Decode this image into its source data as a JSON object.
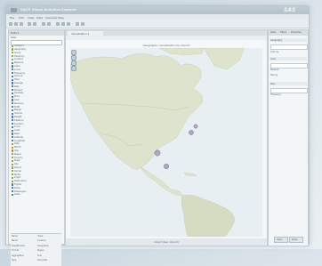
{
  "window": {
    "title": "SAS® Visual Analytics Explorer",
    "logo": "SAS",
    "menu": [
      "File",
      "Edit",
      "View",
      "Data",
      "Visualize",
      "Help"
    ]
  },
  "left_panel": {
    "title": "Data ▾ ",
    "tab": "Data",
    "items": [
      {
        "label": "Category",
        "color": "#8aa24a"
      },
      {
        "label": "Geography",
        "color": "#8aa24a"
      },
      {
        "label": "Group",
        "color": "#8aa24a"
      },
      {
        "label": "Hierarchy",
        "color": "#8aa24a"
      },
      {
        "label": "Location",
        "color": "#8aa24a"
      },
      {
        "label": "Measure",
        "color": "#4a73a8"
      },
      {
        "label": "Value",
        "color": "#4a73a8"
      },
      {
        "label": "Count",
        "color": "#4a73a8"
      },
      {
        "label": "Frequency",
        "color": "#4a73a8"
      },
      {
        "label": "Amount",
        "color": "#4a73a8"
      },
      {
        "label": "Total",
        "color": "#4a73a8"
      },
      {
        "label": "Average",
        "color": "#4a73a8"
      },
      {
        "label": "Rate",
        "color": "#4a73a8"
      },
      {
        "label": "Percent",
        "color": "#4a73a8"
      },
      {
        "label": "Quantity",
        "color": "#4a73a8"
      },
      {
        "label": "Price",
        "color": "#4a73a8"
      },
      {
        "label": "Cost",
        "color": "#4a73a8"
      },
      {
        "label": "Revenue",
        "color": "#4a73a8"
      },
      {
        "label": "Profit",
        "color": "#4a73a8"
      },
      {
        "label": "Margin",
        "color": "#4a73a8"
      },
      {
        "label": "Volume",
        "color": "#4a73a8"
      },
      {
        "label": "Weight",
        "color": "#4a73a8"
      },
      {
        "label": "Distance",
        "color": "#4a73a8"
      },
      {
        "label": "Duration",
        "color": "#4a73a8"
      },
      {
        "label": "Score",
        "color": "#4a73a8"
      },
      {
        "label": "Index",
        "color": "#4a73a8"
      },
      {
        "label": "Ratio",
        "color": "#4a73a8"
      },
      {
        "label": "Latitude",
        "color": "#4a73a8"
      },
      {
        "label": "Longitude",
        "color": "#4a73a8"
      },
      {
        "label": "Date",
        "color": "#b08a3a"
      },
      {
        "label": "Month",
        "color": "#b08a3a"
      },
      {
        "label": "Year",
        "color": "#b08a3a"
      },
      {
        "label": "Region",
        "color": "#8aa24a"
      },
      {
        "label": "Country",
        "color": "#8aa24a"
      },
      {
        "label": "State",
        "color": "#8aa24a"
      },
      {
        "label": "City",
        "color": "#8aa24a"
      },
      {
        "label": "Airport",
        "color": "#8aa24a"
      },
      {
        "label": "Carrier",
        "color": "#8aa24a"
      },
      {
        "label": "Route",
        "color": "#8aa24a"
      },
      {
        "label": "Origin",
        "color": "#8aa24a"
      },
      {
        "label": "Destination",
        "color": "#8aa24a"
      },
      {
        "label": "Flights",
        "color": "#4a73a8"
      },
      {
        "label": "Delay",
        "color": "#4a73a8"
      },
      {
        "label": "Passengers",
        "color": "#4a73a8"
      },
      {
        "label": "Seats",
        "color": "#4a73a8"
      }
    ],
    "properties": {
      "header": [
        "Name",
        "Value"
      ],
      "rows": [
        [
          "Name",
          "Location"
        ],
        [
          "Classification",
          "Geography"
        ],
        [
          "Format",
          "Region"
        ],
        [
          "Aggregation",
          "Sum"
        ],
        [
          "Type",
          "Character"
        ]
      ]
    }
  },
  "center": {
    "tab": "Visualization 1 ",
    "map_title": "Geographic visualization by Airport",
    "footer": "Airport (Geo: Airport)"
  },
  "right_panel": {
    "tabs": [
      "Roles",
      "Filters",
      "Properties"
    ],
    "sections": [
      "Geography",
      "Color",
      "Size"
    ],
    "field_labels": [
      "Color by",
      "Measure",
      "Size by",
      "Frequency"
    ],
    "buttons": [
      "Apply",
      "Reset"
    ]
  },
  "colors": {
    "ocean": "#e8eff3",
    "land": "#dde3cc",
    "land_south": "#d6dcc1",
    "border": "#c2cab0",
    "bubble": "#9c8db3",
    "bubble_stroke": "#6e5f88"
  },
  "map_markers": [
    {
      "id": "marker-1",
      "radius": 3.2
    },
    {
      "id": "marker-2",
      "radius": 2.6
    },
    {
      "id": "marker-3",
      "radius": 2.2
    },
    {
      "id": "marker-4",
      "radius": 2.8
    }
  ]
}
